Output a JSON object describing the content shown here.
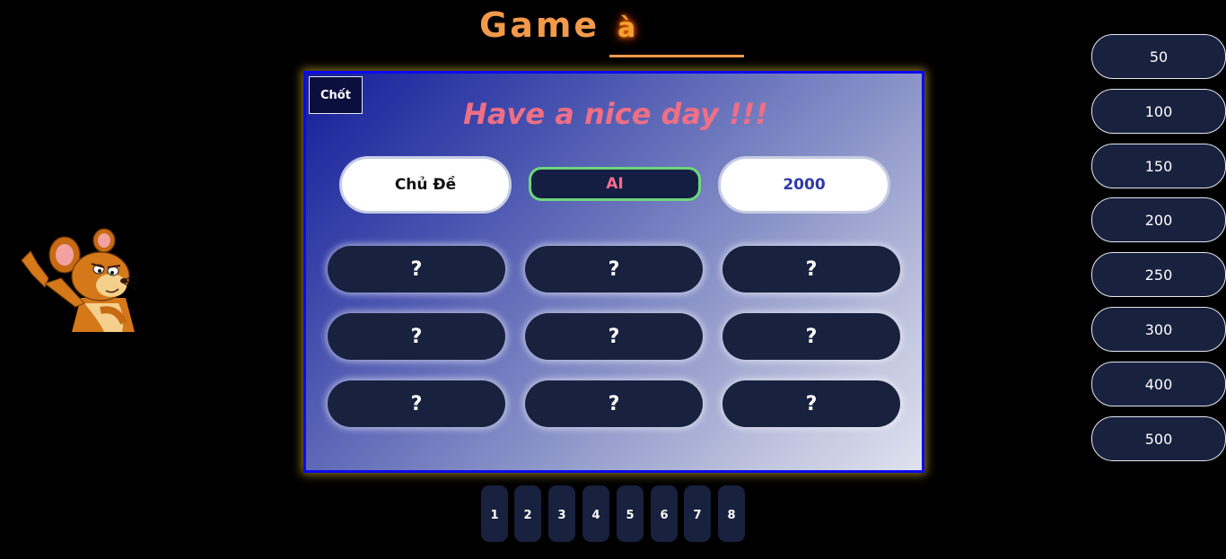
{
  "header": {
    "title": "Game",
    "flame_letter": "à"
  },
  "board": {
    "confirm_label": "Chốt",
    "headline": "Have a nice day !!!",
    "topic_label": "Chủ Đề",
    "team_label": "AI",
    "score_value": "2000",
    "questions": [
      "?",
      "?",
      "?",
      "?",
      "?",
      "?",
      "?",
      "?",
      "?"
    ]
  },
  "numbers": [
    "1",
    "2",
    "3",
    "4",
    "5",
    "6",
    "7",
    "8"
  ],
  "points": [
    "50",
    "100",
    "150",
    "200",
    "250",
    "300",
    "400",
    "500"
  ],
  "colors": {
    "background": "#000000",
    "title": "#f2994a",
    "headline": "#ef6f85",
    "button_dark": "#18213e",
    "board_border": "#0a0aee",
    "team_border": "#6fd67a",
    "score_text": "#2e3aa8"
  },
  "mascot": {
    "icon": "jerry-mouse-icon"
  }
}
